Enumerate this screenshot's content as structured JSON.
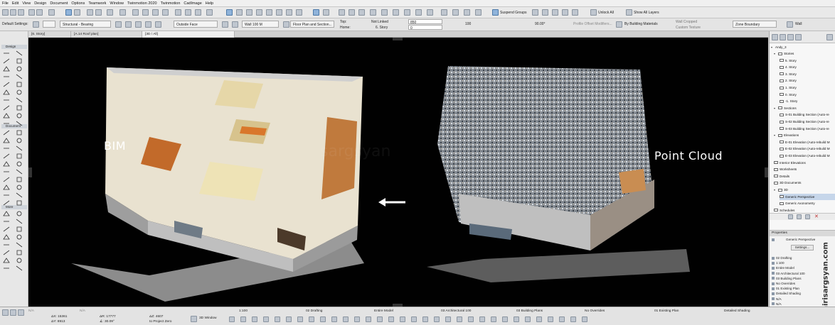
{
  "menu": [
    "File",
    "Edit",
    "View",
    "Design",
    "Document",
    "Options",
    "Teamwork",
    "Window",
    "Twinmotion 2020",
    "Twinmotion",
    "CadImage",
    "Help"
  ],
  "toolbar": {
    "suspend_groups": "Suspend Groups",
    "unlock_all": "Unlock All",
    "show_all_layers": "Show All Layers"
  },
  "infobox": {
    "default_settings": "Default Settings:",
    "structural": "Structural - Bearing",
    "outside_face": "Outside Face",
    "wall_layer": "Wall 100 M",
    "floor_plan_section": "Floor Plan and Section...",
    "top_label": "Top:",
    "home_label": "Home:",
    "not_linked": "Not Linked",
    "story": "6. Story",
    "height_value": "850",
    "offset_value": "0",
    "thickness": "100",
    "angle": "90.00°",
    "profile_offset": "Profile Offset Modifiers...",
    "by_building_materials": "By Building Materials",
    "wall_cropped": "Wall Cropped",
    "custom_texture": "Custom Texture",
    "zone_boundary": "Zone Boundary",
    "wall_tool": "Wall"
  },
  "tabs": [
    {
      "label": "[6. Story]",
      "active": false
    },
    {
      "label": "[A.14 Roof plan]",
      "active": false
    },
    {
      "label": "[3D / All]",
      "active": true
    }
  ],
  "toolbox": {
    "design": "Design",
    "document": "Document",
    "more": "More"
  },
  "viewport": {
    "left_label": "BIM",
    "right_label": "Point Cloud",
    "watermark": "sargsyan"
  },
  "navigator": {
    "root": "Andy_3",
    "items": [
      {
        "label": "Stories",
        "level": 1,
        "type": "group"
      },
      {
        "label": "5. Story",
        "level": 2,
        "type": "item"
      },
      {
        "label": "4. Story",
        "level": 2,
        "type": "item"
      },
      {
        "label": "3. Story",
        "level": 2,
        "type": "item"
      },
      {
        "label": "2. Story",
        "level": 2,
        "type": "item"
      },
      {
        "label": "1. Story",
        "level": 2,
        "type": "item"
      },
      {
        "label": "0. Story",
        "level": 2,
        "type": "item"
      },
      {
        "label": "-1. Story",
        "level": 2,
        "type": "item"
      },
      {
        "label": "Sections",
        "level": 1,
        "type": "group"
      },
      {
        "label": "S-01 Building Section (Auto-re",
        "level": 2,
        "type": "item"
      },
      {
        "label": "S-02 Building Section (Auto-re",
        "level": 2,
        "type": "item"
      },
      {
        "label": "S-03 Building Section (Auto-re",
        "level": 2,
        "type": "item"
      },
      {
        "label": "Elevations",
        "level": 1,
        "type": "group"
      },
      {
        "label": "E-01 Elevation (Auto-rebuild M",
        "level": 2,
        "type": "item"
      },
      {
        "label": "E-02 Elevation (Auto-rebuild M",
        "level": 2,
        "type": "item"
      },
      {
        "label": "E-03 Elevation (Auto-rebuild M",
        "level": 2,
        "type": "item"
      },
      {
        "label": "Interior Elevations",
        "level": 1,
        "type": "item"
      },
      {
        "label": "Worksheets",
        "level": 1,
        "type": "item"
      },
      {
        "label": "Details",
        "level": 1,
        "type": "item"
      },
      {
        "label": "3D Documents",
        "level": 1,
        "type": "item"
      },
      {
        "label": "3D",
        "level": 1,
        "type": "group"
      },
      {
        "label": "Generic Perspective",
        "level": 2,
        "type": "selected"
      },
      {
        "label": "Generic Axonometry",
        "level": 2,
        "type": "item"
      },
      {
        "label": "Schedules",
        "level": 1,
        "type": "item"
      }
    ]
  },
  "properties": {
    "title": "Properties",
    "view_name": "Generic Perspective",
    "settings": "Settings...",
    "rows": [
      "02 Drafting",
      "1:100",
      "Entire Model",
      "03 Architectural 100",
      "03 Building Plans",
      "No Overrides",
      "01 Existing Plan",
      "Detailed Shading",
      "N/A",
      "N/A"
    ]
  },
  "brand": "nairisargsyan.com",
  "statusbar": {
    "dx": "ΔX: 15361",
    "dy": "ΔY: 8913",
    "dr": "ΔR: 17777",
    "angle": "∡: 30.09°",
    "dz": "ΔZ: 4607",
    "to_project_zero": "to Project Zero",
    "na": "N/A",
    "window_3d": "3D Window",
    "scale": "1:100",
    "drafting": "02 Drafting",
    "model": "Entire Model",
    "arch": "03 Architectural 100",
    "plans": "03 Building Plans",
    "overrides": "No Overrides",
    "existing": "01 Existing Plan",
    "shading": "Detailed Shading"
  }
}
